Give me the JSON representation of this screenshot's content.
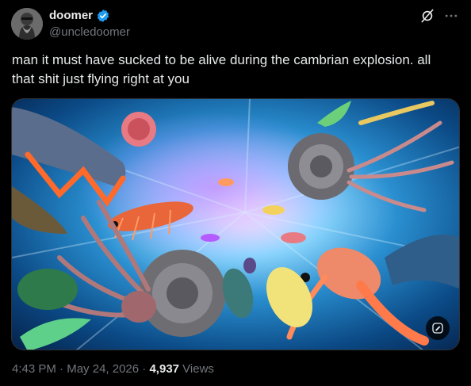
{
  "post": {
    "display_name": "doomer",
    "handle": "@uncledoomer",
    "verified": true,
    "text": "man it must have sucked to be alive during the cambrian explosion. all that shit just flying right at you",
    "time": "4:43 PM",
    "separator": " · ",
    "date": "May 24, 2026",
    "views_count": "4,937",
    "views_label": " Views"
  },
  "icons": {
    "verified": "verified-badge-icon",
    "grok": "grok-icon",
    "more": "more-icon",
    "image_edit": "image-edit-icon"
  },
  "colors": {
    "background": "#000000",
    "text_primary": "#e7e9ea",
    "text_secondary": "#71767b",
    "verified_blue": "#1d9bf0"
  }
}
